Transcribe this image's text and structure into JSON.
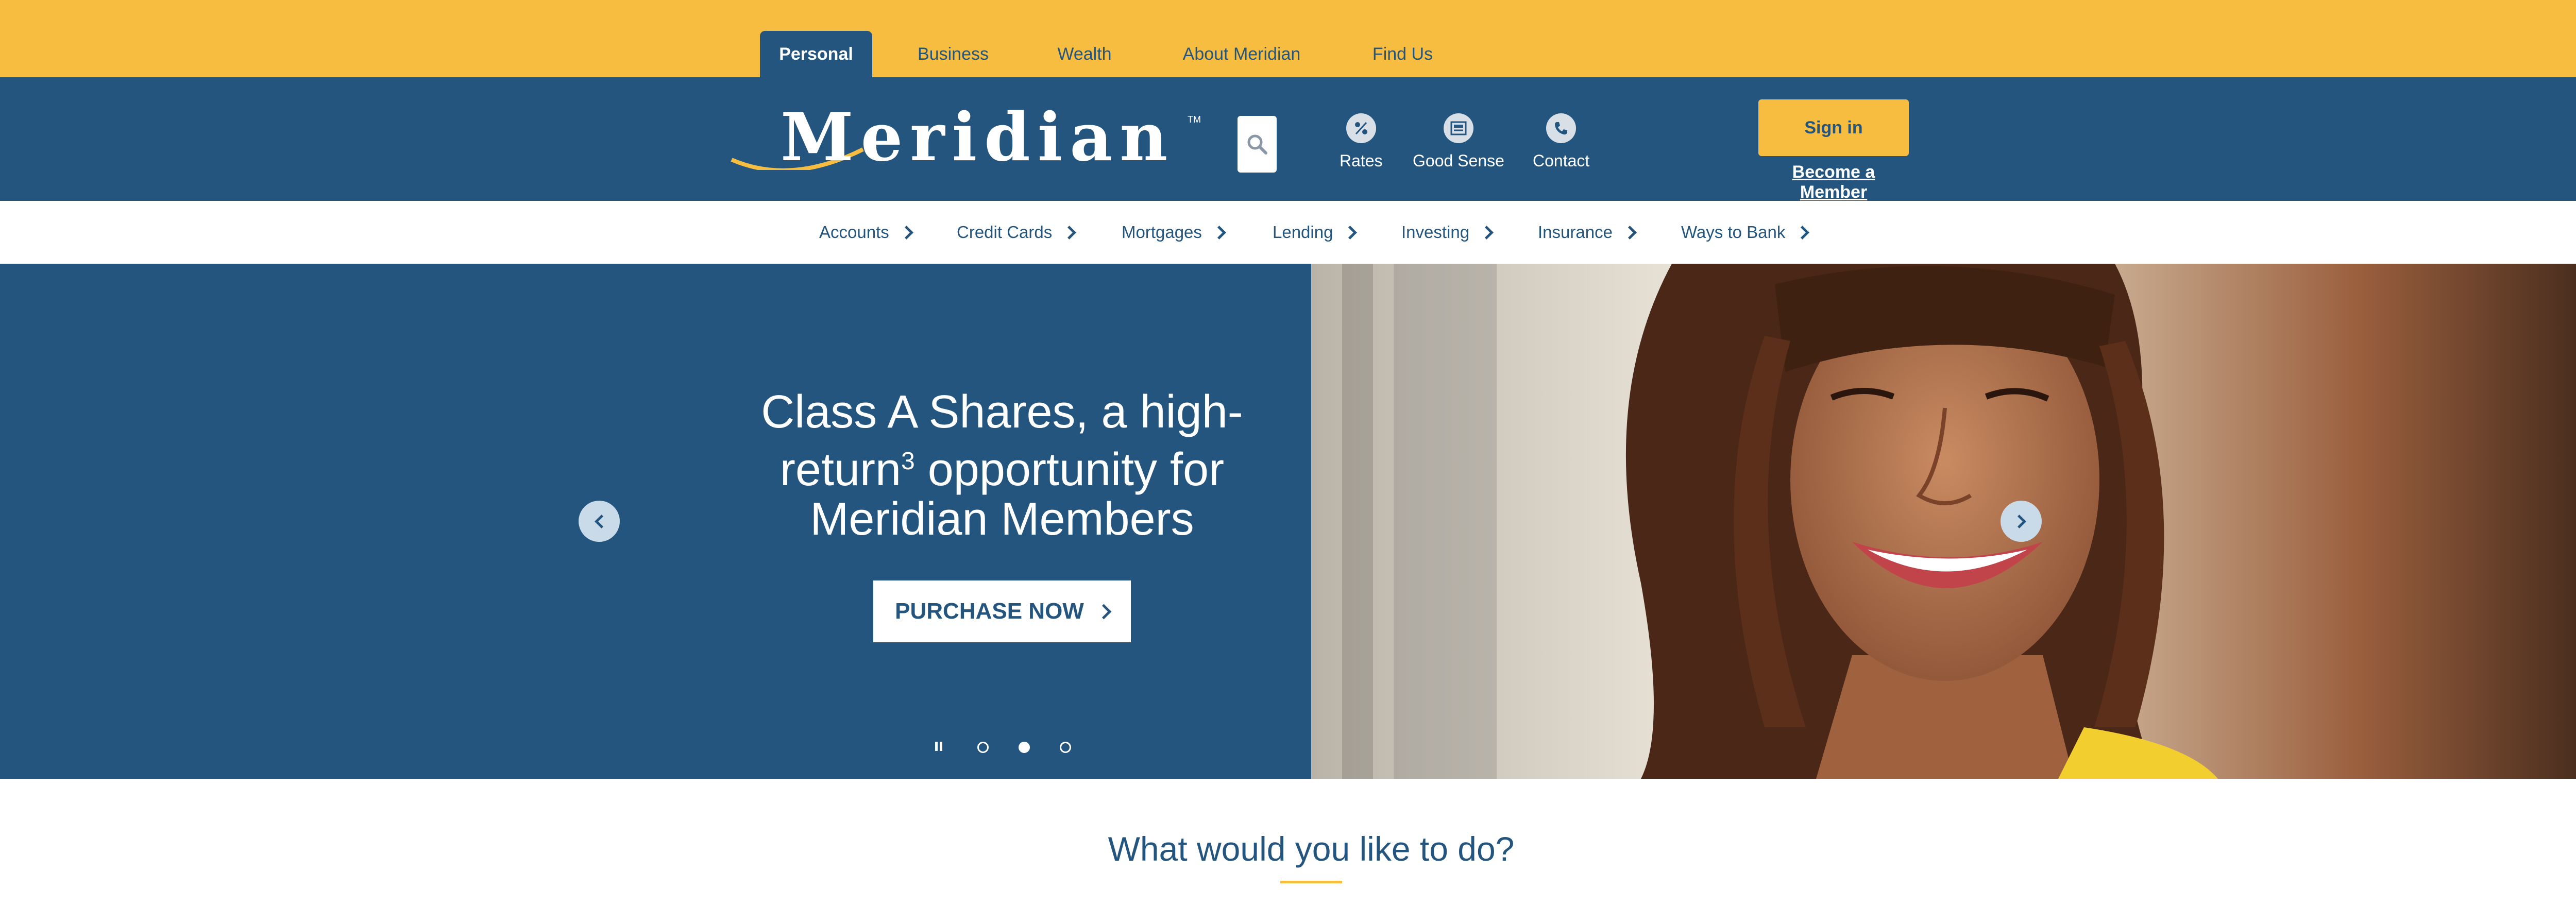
{
  "top_tabs": [
    {
      "label": "Personal",
      "active": true
    },
    {
      "label": "Business"
    },
    {
      "label": "Wealth"
    },
    {
      "label": "About Meridian"
    },
    {
      "label": "Find Us"
    }
  ],
  "header": {
    "logo_text": "Meridian",
    "logo_tm": "TM",
    "links": [
      {
        "label": "Rates",
        "icon": "percent-icon"
      },
      {
        "label": "Good Sense",
        "icon": "newspaper-icon"
      },
      {
        "label": "Contact",
        "icon": "phone-icon"
      }
    ],
    "signin_label": "Sign in",
    "become_label": "Become a Member"
  },
  "nav": [
    "Accounts",
    "Credit Cards",
    "Mortgages",
    "Lending",
    "Investing",
    "Insurance",
    "Ways to Bank"
  ],
  "hero": {
    "title_line1": "Class A Shares, a high-",
    "title_line2a": "return",
    "title_sup": "3",
    "title_line2b": " opportunity for",
    "title_line3": "Meridian Members",
    "cta_label": "PURCHASE NOW",
    "slides_total": 3,
    "active_slide": 2
  },
  "section_title": "What would you like to do?",
  "colors": {
    "brand_blue": "#23557e",
    "brand_yellow": "#f6bd41"
  }
}
